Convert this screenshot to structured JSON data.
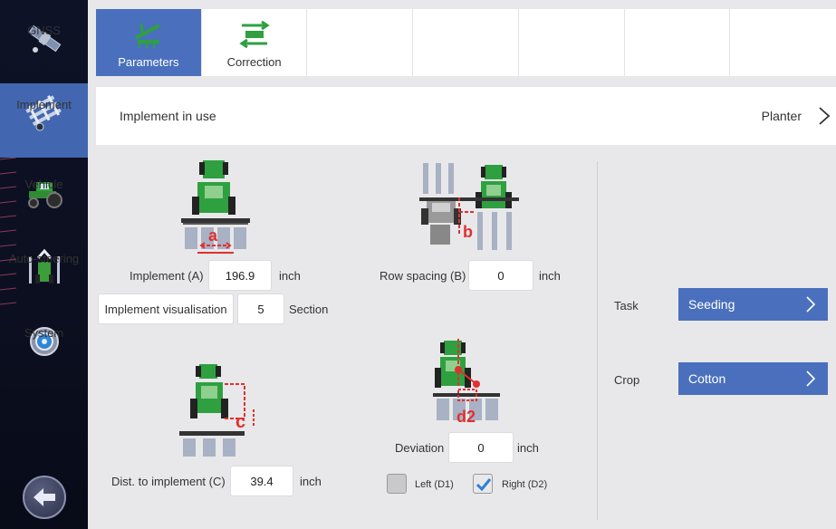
{
  "sidebar": {
    "items": [
      {
        "label": "GNSS",
        "icon": "satellite-icon"
      },
      {
        "label": "Implement",
        "icon": "implement-icon"
      },
      {
        "label": "Vehicle",
        "icon": "tractor-icon"
      },
      {
        "label": "Auto-steering",
        "icon": "auto-steering-icon"
      },
      {
        "label": "System",
        "icon": "system-gear-icon"
      }
    ],
    "active_index": 1,
    "back_icon": "back-arrow-icon"
  },
  "tabs": [
    {
      "label": "Parameters",
      "icon": "seeder-icon",
      "active": true
    },
    {
      "label": "Correction",
      "icon": "correction-icon",
      "active": false
    },
    {
      "label": ""
    },
    {
      "label": ""
    },
    {
      "label": ""
    },
    {
      "label": ""
    },
    {
      "label": ""
    }
  ],
  "implement_in_use": {
    "title": "Implement in use",
    "value": "Planter"
  },
  "implement_a": {
    "label": "Implement (A)",
    "value": "196.9",
    "unit": "inch",
    "marker": "a"
  },
  "visualisation": {
    "label": "Implement visualisation",
    "value": "5",
    "unit": "Section"
  },
  "row_spacing": {
    "label": "Row spacing (B)",
    "value": "0",
    "unit": "inch",
    "marker": "b"
  },
  "dist_implement": {
    "label": "Dist. to implement (C)",
    "value": "39.4",
    "unit": "inch",
    "marker": "c"
  },
  "deviation": {
    "label": "Deviation",
    "value": "0",
    "unit": "inch",
    "marker": "d2"
  },
  "checkboxes": [
    {
      "label": "Left (D1)",
      "checked": false
    },
    {
      "label": "Right (D2)",
      "checked": true
    }
  ],
  "task": {
    "label": "Task",
    "value": "Seeding"
  },
  "crop": {
    "label": "Crop",
    "value": "Cotton"
  },
  "colors": {
    "accent_blue": "#4a70bd",
    "sidebar_bg": "#0d1226",
    "tractor_green": "#2f9e3a",
    "marker_red": "#e03030",
    "bar_gray": "#9aa3b8"
  }
}
